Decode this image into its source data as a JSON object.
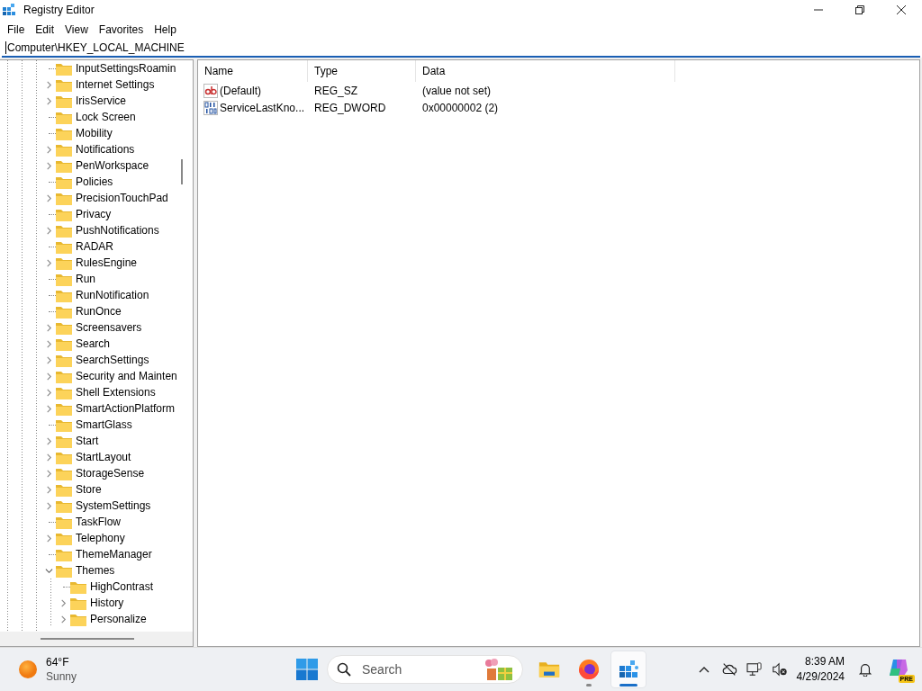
{
  "window": {
    "title": "Registry Editor"
  },
  "menu": [
    "File",
    "Edit",
    "View",
    "Favorites",
    "Help"
  ],
  "address_bar": {
    "value": "Computer\\HKEY_LOCAL_MACHINE"
  },
  "tree": [
    {
      "label": "InputSettingsRoamin",
      "expandable": false,
      "expanded": false
    },
    {
      "label": "Internet Settings",
      "expandable": true,
      "expanded": false
    },
    {
      "label": "IrisService",
      "expandable": true,
      "expanded": false
    },
    {
      "label": "Lock Screen",
      "expandable": false,
      "expanded": false
    },
    {
      "label": "Mobility",
      "expandable": false,
      "expanded": false
    },
    {
      "label": "Notifications",
      "expandable": true,
      "expanded": false
    },
    {
      "label": "PenWorkspace",
      "expandable": true,
      "expanded": false
    },
    {
      "label": "Policies",
      "expandable": false,
      "expanded": false
    },
    {
      "label": "PrecisionTouchPad",
      "expandable": true,
      "expanded": false
    },
    {
      "label": "Privacy",
      "expandable": false,
      "expanded": false
    },
    {
      "label": "PushNotifications",
      "expandable": true,
      "expanded": false
    },
    {
      "label": "RADAR",
      "expandable": false,
      "expanded": false
    },
    {
      "label": "RulesEngine",
      "expandable": true,
      "expanded": false
    },
    {
      "label": "Run",
      "expandable": false,
      "expanded": false
    },
    {
      "label": "RunNotification",
      "expandable": false,
      "expanded": false
    },
    {
      "label": "RunOnce",
      "expandable": false,
      "expanded": false
    },
    {
      "label": "Screensavers",
      "expandable": true,
      "expanded": false
    },
    {
      "label": "Search",
      "expandable": true,
      "expanded": false
    },
    {
      "label": "SearchSettings",
      "expandable": true,
      "expanded": false
    },
    {
      "label": "Security and Mainten",
      "expandable": true,
      "expanded": false
    },
    {
      "label": "Shell Extensions",
      "expandable": true,
      "expanded": false
    },
    {
      "label": "SmartActionPlatform",
      "expandable": true,
      "expanded": false
    },
    {
      "label": "SmartGlass",
      "expandable": false,
      "expanded": false
    },
    {
      "label": "Start",
      "expandable": true,
      "expanded": false
    },
    {
      "label": "StartLayout",
      "expandable": true,
      "expanded": false
    },
    {
      "label": "StorageSense",
      "expandable": true,
      "expanded": false
    },
    {
      "label": "Store",
      "expandable": true,
      "expanded": false
    },
    {
      "label": "SystemSettings",
      "expandable": true,
      "expanded": false
    },
    {
      "label": "TaskFlow",
      "expandable": false,
      "expanded": false
    },
    {
      "label": "Telephony",
      "expandable": true,
      "expanded": false
    },
    {
      "label": "ThemeManager",
      "expandable": false,
      "expanded": false
    },
    {
      "label": "Themes",
      "expandable": true,
      "expanded": true,
      "children": [
        {
          "label": "HighContrast",
          "expandable": false,
          "expanded": false
        },
        {
          "label": "History",
          "expandable": true,
          "expanded": false
        },
        {
          "label": "Personalize",
          "expandable": true,
          "expanded": false
        }
      ]
    }
  ],
  "values_table": {
    "columns": [
      "Name",
      "Type",
      "Data"
    ],
    "rows": [
      {
        "kind": "string",
        "name": "(Default)",
        "type": "REG_SZ",
        "data": "(value not set)"
      },
      {
        "kind": "binary",
        "name": "ServiceLastKno...",
        "type": "REG_DWORD",
        "data": "0x00000002 (2)"
      }
    ]
  },
  "taskbar": {
    "weather": {
      "temperature": "64°F",
      "condition": "Sunny"
    },
    "search": {
      "placeholder": "Search"
    },
    "apps": [
      {
        "kind": "explorer",
        "running": false,
        "active": false
      },
      {
        "kind": "firefox",
        "running": true,
        "active": false
      },
      {
        "kind": "regedit",
        "running": true,
        "active": true
      }
    ],
    "clock": {
      "time": "8:39 AM",
      "date": "4/29/2024"
    },
    "copilot_badge": "PRE"
  }
}
